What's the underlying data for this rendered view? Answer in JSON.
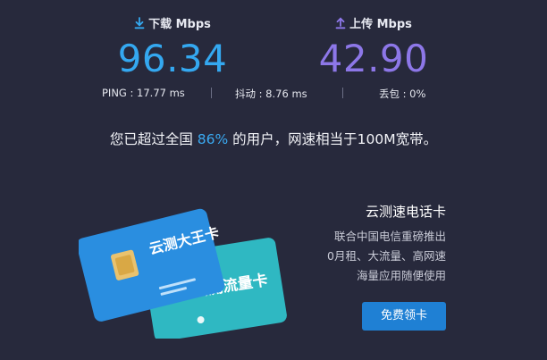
{
  "download": {
    "label": "下载 Mbps",
    "value": "96.34"
  },
  "upload": {
    "label": "上传 Mbps",
    "value": "42.90"
  },
  "stats": {
    "ping": "PING : 17.77 ms",
    "jitter": "抖动 : 8.76 ms",
    "loss": "丢包 : 0%"
  },
  "summary": {
    "prefix": "您已超过全国 ",
    "percent": "86%",
    "suffix": " 的用户，网速相当于100M宽带。"
  },
  "promo": {
    "title": "云测速电话卡",
    "lines": [
      "联合中国电信重磅推出",
      "0月租、大流量、高网速",
      "海量应用随便使用"
    ],
    "cta": "免费领卡"
  },
  "cards": {
    "card1_text": "云测大王卡",
    "card2_text": "云测流量卡"
  },
  "colors": {
    "download": "#34a8f0",
    "upload": "#8d77e8",
    "button": "#1f80d4",
    "background": "#27293c"
  },
  "icons": {
    "download": "download-arrow-icon",
    "upload": "upload-arrow-icon"
  }
}
